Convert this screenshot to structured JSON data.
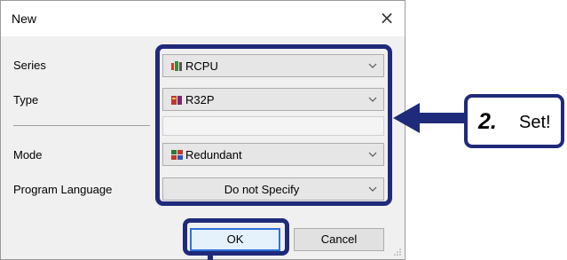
{
  "dialog": {
    "title": "New",
    "close_glyph": "×"
  },
  "fields": {
    "series": {
      "label": "Series",
      "value": "RCPU",
      "icon": "cpu-series-icon"
    },
    "type": {
      "label": "Type",
      "value": "R32P",
      "icon": "cpu-type-icon"
    },
    "mode": {
      "label": "Mode",
      "value": "Redundant",
      "icon": "redundant-mode-icon"
    },
    "program_language": {
      "label": "Program Language",
      "value": "Do not Specify"
    }
  },
  "buttons": {
    "ok": "OK",
    "cancel": "Cancel"
  },
  "callout": {
    "step": "2.",
    "text": "Set!"
  },
  "colors": {
    "annotation": "#1f2a7a",
    "dialog_bg": "#f0f0f0",
    "ok_focus": "#2e72d9"
  }
}
